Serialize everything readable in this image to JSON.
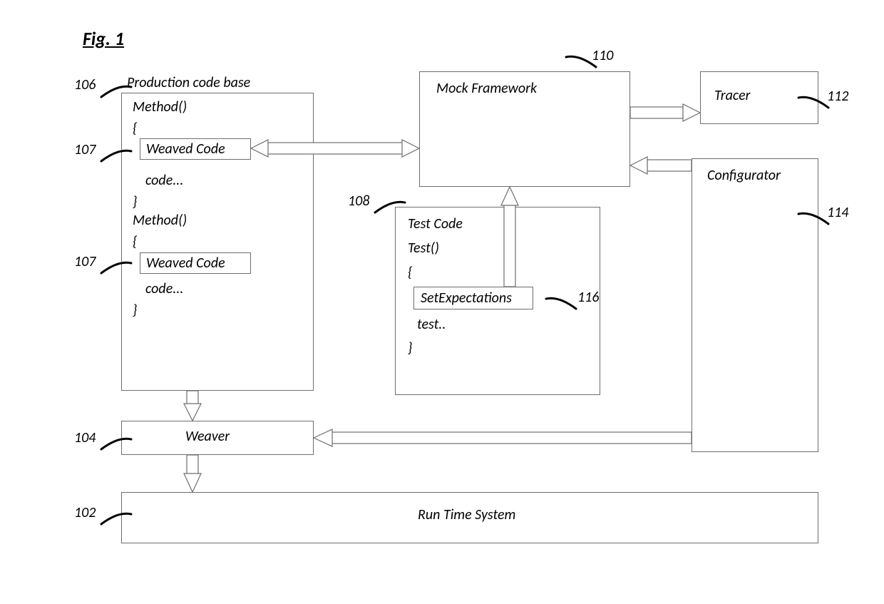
{
  "figure": {
    "title": "Fig. 1"
  },
  "labels": {
    "ref_106": "106",
    "ref_107a": "107",
    "ref_107b": "107",
    "ref_108": "108",
    "ref_110": "110",
    "ref_112": "112",
    "ref_114": "114",
    "ref_116": "116",
    "ref_104": "104",
    "ref_102": "102",
    "prod_title": "Production code base",
    "method1": "Method()",
    "brace_open1": "{",
    "weaved1": "Weaved Code",
    "code1": "code...",
    "brace_close1": "}",
    "method2": "Method()",
    "brace_open2": "{",
    "weaved2": "Weaved Code",
    "code2": "code...",
    "brace_close2": "}",
    "mock": "Mock Framework",
    "tracer": "Tracer",
    "configurator": "Configurator",
    "test_title": "Test Code",
    "test_fn": "Test()",
    "test_brace_open": "{",
    "setexp": "SetExpectations",
    "test_line": "test..",
    "test_brace_close": "}",
    "weaver": "Weaver",
    "runtime": "Run Time System"
  }
}
